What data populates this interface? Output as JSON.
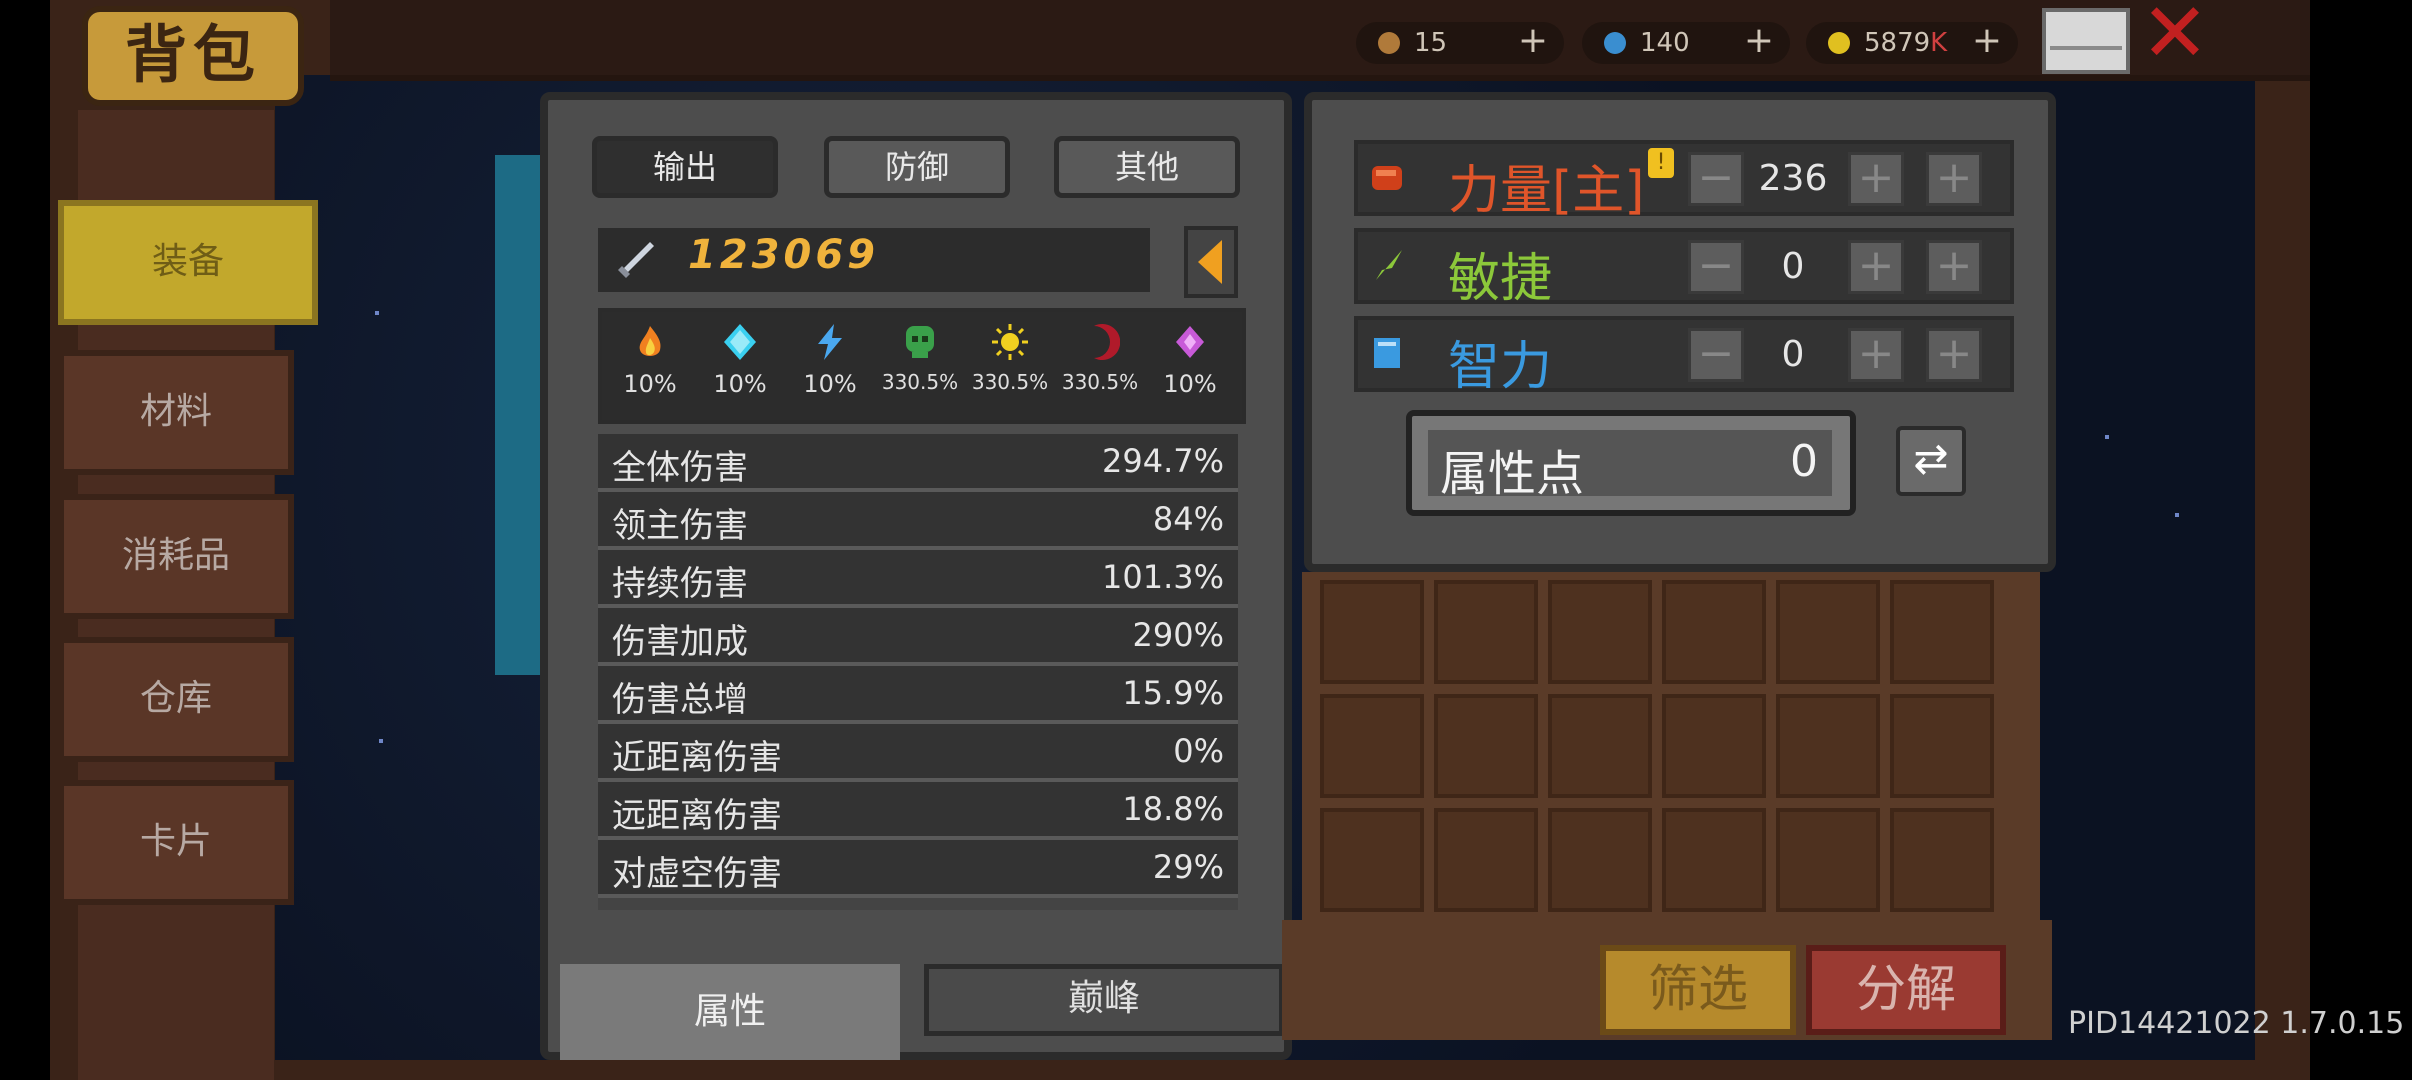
{
  "header": {
    "title": "背包",
    "currencies": [
      {
        "icon": "potion-icon",
        "value": "15",
        "plus": "+",
        "color": "#b07a3a"
      },
      {
        "icon": "gem-icon",
        "value": "140",
        "plus": "+",
        "color": "#3a8ed0"
      },
      {
        "icon": "coin-icon",
        "value": "5879",
        "suffix": "K",
        "plus": "+",
        "color": "#e0c020"
      }
    ],
    "mail_icon": "mail-icon",
    "close_label": "✕"
  },
  "sidebar": {
    "items": [
      {
        "label": "装备",
        "selected": true
      },
      {
        "label": "材料"
      },
      {
        "label": "消耗品"
      },
      {
        "label": "仓库"
      },
      {
        "label": "卡片"
      }
    ]
  },
  "stats_panel": {
    "tabs": [
      {
        "label": "输出",
        "selected": true
      },
      {
        "label": "防御"
      },
      {
        "label": "其他"
      }
    ],
    "power": "123069",
    "elements": [
      {
        "icon": "fire-icon",
        "value": "10%",
        "color": "#f08020"
      },
      {
        "icon": "ice-icon",
        "value": "10%",
        "color": "#3ad0f0"
      },
      {
        "icon": "lightning-icon",
        "value": "10%",
        "color": "#4aa8f0"
      },
      {
        "icon": "poison-skull-icon",
        "value": "330.5%",
        "color": "#3aa04a"
      },
      {
        "icon": "light-sun-icon",
        "value": "330.5%",
        "color": "#f0d020"
      },
      {
        "icon": "dark-moon-icon",
        "value": "330.5%",
        "color": "#b01a2a"
      },
      {
        "icon": "void-crystal-icon",
        "value": "10%",
        "color": "#c85ad8"
      }
    ],
    "rows": [
      {
        "name": "全体伤害",
        "value": "294.7%"
      },
      {
        "name": "领主伤害",
        "value": "84%"
      },
      {
        "name": "持续伤害",
        "value": "101.3%"
      },
      {
        "name": "伤害加成",
        "value": "290%"
      },
      {
        "name": "伤害总增",
        "value": "15.9%"
      },
      {
        "name": "近距离伤害",
        "value": "0%"
      },
      {
        "name": "远距离伤害",
        "value": "18.8%"
      },
      {
        "name": "对虚空伤害",
        "value": "29%"
      }
    ],
    "bottom_tabs": [
      {
        "label": "属性",
        "selected": true
      },
      {
        "label": "巅峰"
      }
    ]
  },
  "attributes": {
    "rows": [
      {
        "icon": "fist-icon",
        "name": "力量[主]",
        "value": "236",
        "color": "#e0552a",
        "badge": "!"
      },
      {
        "icon": "feather-icon",
        "name": "敏捷",
        "value": "0",
        "color": "#8cc83a"
      },
      {
        "icon": "book-icon",
        "name": "智力",
        "value": "0",
        "color": "#3a9ae0"
      }
    ],
    "points_label": "属性点",
    "points_value": "0"
  },
  "actions": {
    "filter": "筛选",
    "decompose": "分解"
  },
  "version": "PID14421022 1.7.0.15"
}
